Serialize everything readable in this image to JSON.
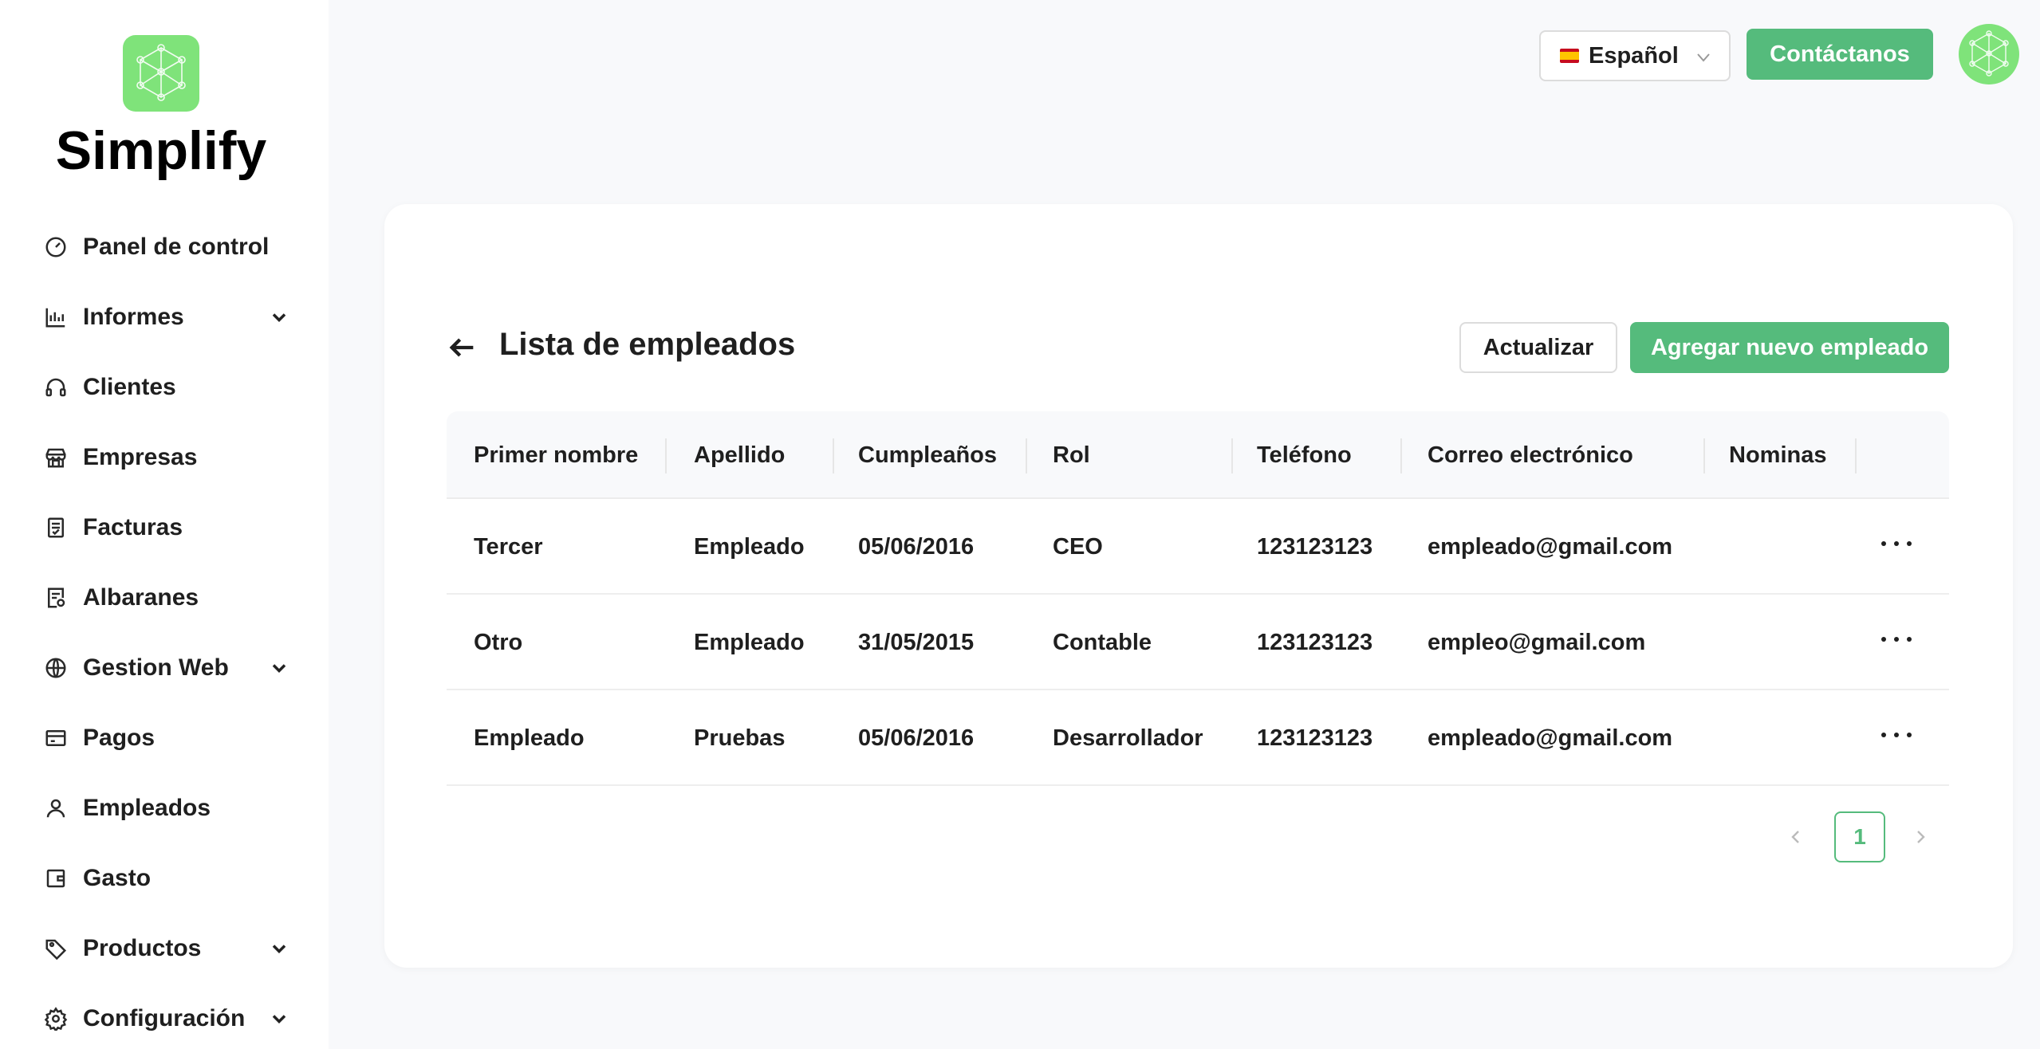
{
  "brand": {
    "name": "Simplify",
    "logo_icon": "network-cube-icon",
    "accent": "#7fe37a"
  },
  "sidebar": {
    "items": [
      {
        "label": "Panel de control",
        "icon": "dashboard-gauge-icon",
        "expandable": false
      },
      {
        "label": "Informes",
        "icon": "bar-chart-icon",
        "expandable": true
      },
      {
        "label": "Clientes",
        "icon": "headphones-icon",
        "expandable": false
      },
      {
        "label": "Empresas",
        "icon": "store-icon",
        "expandable": false
      },
      {
        "label": "Facturas",
        "icon": "invoice-icon",
        "expandable": false
      },
      {
        "label": "Albaranes",
        "icon": "delivery-note-icon",
        "expandable": false
      },
      {
        "label": "Gestion Web",
        "icon": "globe-icon",
        "expandable": true
      },
      {
        "label": "Pagos",
        "icon": "credit-card-icon",
        "expandable": false
      },
      {
        "label": "Empleados",
        "icon": "user-icon",
        "expandable": false
      },
      {
        "label": "Gasto",
        "icon": "wallet-icon",
        "expandable": false
      },
      {
        "label": "Productos",
        "icon": "tag-icon",
        "expandable": true
      },
      {
        "label": "Configuración",
        "icon": "gear-icon",
        "expandable": true
      }
    ]
  },
  "header": {
    "language": "Español",
    "language_flag": "spain-flag-icon",
    "contact_label": "Contáctanos",
    "contact_color": "#55bb7c"
  },
  "main": {
    "title": "Lista de empleados",
    "refresh_label": "Actualizar",
    "add_label": "Agregar nuevo empleado",
    "table": {
      "columns": [
        "Primer nombre",
        "Apellido",
        "Cumpleaños",
        "Rol",
        "Teléfono",
        "Correo electrónico",
        "Nominas"
      ],
      "rows": [
        {
          "first_name": "Tercer",
          "last_name": "Empleado",
          "birthday": "05/06/2016",
          "role": "CEO",
          "phone": "123123123",
          "email": "empleado@gmail.com",
          "payroll": ""
        },
        {
          "first_name": "Otro",
          "last_name": "Empleado",
          "birthday": "31/05/2015",
          "role": "Contable",
          "phone": "123123123",
          "email": "empleo@gmail.com",
          "payroll": ""
        },
        {
          "first_name": "Empleado",
          "last_name": "Pruebas",
          "birthday": "05/06/2016",
          "role": "Desarrollador",
          "phone": "123123123",
          "email": "empleado@gmail.com",
          "payroll": ""
        }
      ]
    },
    "pagination": {
      "current_page": "1"
    }
  }
}
